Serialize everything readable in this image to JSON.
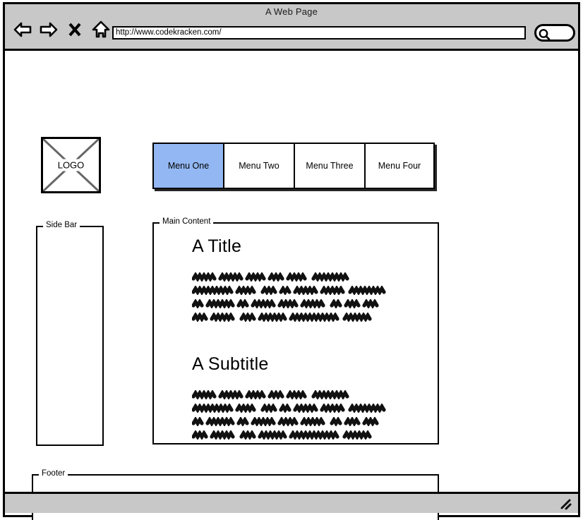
{
  "window": {
    "title": "A Web Page",
    "url_value": "http://www.codekracken.com/",
    "url_placeholder": "Enter a URL",
    "search_placeholder": "Search",
    "search_value": ""
  },
  "nav": {
    "back_icon": "back-arrow-icon",
    "forward_icon": "forward-arrow-icon",
    "stop_icon": "close-x-icon",
    "home_icon": "home-icon",
    "search_icon": "search-magnifier-icon"
  },
  "logo": {
    "label": "LOGO",
    "icon": "image-placeholder-cross-icon"
  },
  "menu": {
    "tabs": [
      {
        "label": "Menu One",
        "active": true
      },
      {
        "label": "Menu Two",
        "active": false
      },
      {
        "label": "Menu Three",
        "active": false
      },
      {
        "label": "Menu Four",
        "active": false
      }
    ],
    "active_color": "#92b7f2"
  },
  "sidebar": {
    "label": "Side Bar",
    "items": []
  },
  "main": {
    "label": "Main Content",
    "title": "A Title",
    "subtitle": "A Subtitle",
    "body_text_style": "scribble-placeholder",
    "paragraph_line_count": 4
  },
  "footer": {
    "label": "Footer",
    "items": []
  },
  "statusbar": {
    "text": "",
    "resize_icon": "resize-grip-icon"
  },
  "colors": {
    "chrome": "#c8c8c8",
    "ink": "#000000",
    "page": "#ffffff",
    "accent": "#92b7f2"
  }
}
